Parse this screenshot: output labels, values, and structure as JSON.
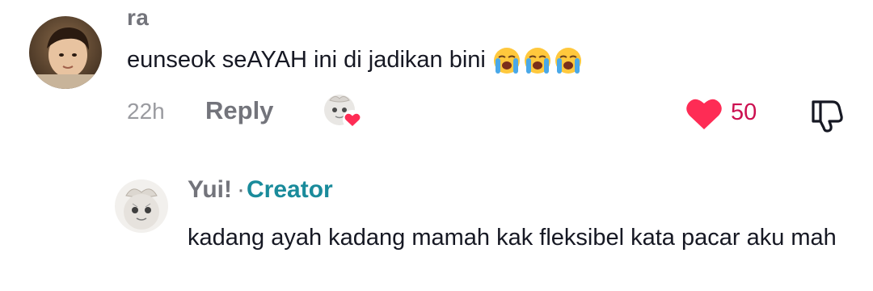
{
  "comment": {
    "username": "ra",
    "text": "eunseok seAYAH ini di jadikan bini",
    "emojis": [
      "loudly-crying-face",
      "loudly-crying-face",
      "loudly-crying-face"
    ],
    "time": "22h",
    "reply_label": "Reply",
    "like_count": "50",
    "liked": true,
    "creator_liked": true,
    "colors": {
      "heart": "#fe2c55",
      "like_count": "#cc1050",
      "meta": "#73747b"
    }
  },
  "reply": {
    "username": "Yui!",
    "separator": "·",
    "badge": "Creator",
    "text": "kadang ayah kadang mamah kak fleksibel kata pacar aku mah",
    "colors": {
      "badge": "#1a8b9b"
    }
  }
}
